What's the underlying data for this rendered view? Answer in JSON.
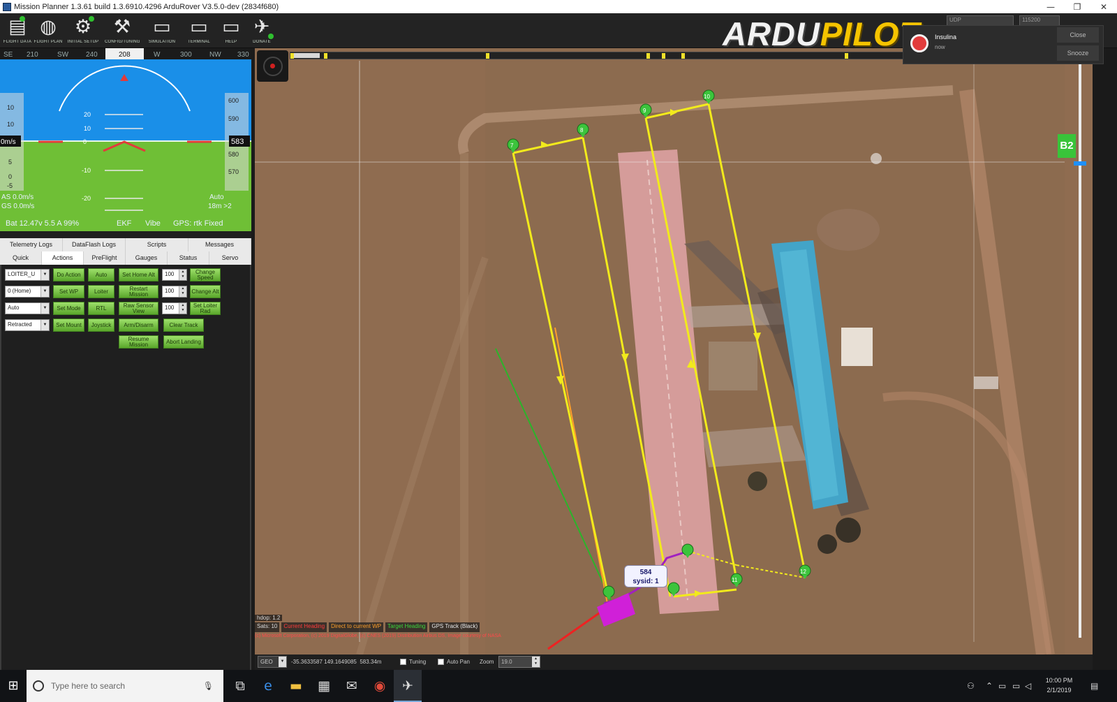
{
  "window": {
    "title": "Mission Planner 1.3.61 build 1.3.6910.4296 ArduRover V3.5.0-dev (2834f680)",
    "controls": [
      "—",
      "❐",
      "✕"
    ]
  },
  "toolbar": {
    "buttons": [
      {
        "label": "FLIGHT DATA",
        "glyph": "▤"
      },
      {
        "label": "FLIGHT PLAN",
        "glyph": "◍"
      },
      {
        "label": "INITIAL SETUP",
        "glyph": "⚙"
      },
      {
        "label": "CONFIG/TUNING",
        "glyph": "⚒"
      },
      {
        "label": "SIMULATION",
        "glyph": "▭"
      },
      {
        "label": "TERMINAL",
        "glyph": "▭"
      },
      {
        "label": "HELP",
        "glyph": "▭"
      },
      {
        "label": "DONATE",
        "glyph": "✈"
      }
    ],
    "logo_part1": "ARDU",
    "logo_part2": "PILOT",
    "connection_port": "UDP",
    "baud_rate": "115200"
  },
  "notification": {
    "title": "Insulina",
    "time": "now",
    "close_label": "Close",
    "snooze_label": "Snooze"
  },
  "hud": {
    "heading_ticks": [
      "SE",
      "210",
      "SW",
      "240",
      "W",
      "300",
      "NW",
      "330"
    ],
    "heading_value": "208",
    "ground_speed": "0m/s",
    "altitude": "583",
    "alt_ticks": [
      "600",
      "590",
      "580",
      "570"
    ],
    "speed_ticks": [
      "10",
      "10",
      "5",
      "0",
      "-5"
    ],
    "pitch_ticks": [
      "20",
      "10",
      "0",
      "-10",
      "-20"
    ],
    "airspeed": "AS 0.0m/s",
    "groundspeed": "GS 0.0m/s",
    "mode": "Auto",
    "wp_distance": "18m >2",
    "battery": "Bat 12.47v 5.5 A 99%",
    "ekf": "EKF",
    "vibe": "Vibe",
    "gps": "GPS: rtk Fixed",
    "colors": {
      "sky": "#1a8fe8",
      "ground": "#6fbf36"
    }
  },
  "tabs": {
    "row1": [
      "Telemetry Logs",
      "DataFlash Logs",
      "Scripts",
      "Messages"
    ],
    "row2": [
      "Quick",
      "Actions",
      "PreFlight",
      "Gauges",
      "Status",
      "Servo"
    ],
    "active": "Actions"
  },
  "actions": {
    "combos": [
      "LOITER_U",
      "0 (Home)",
      "Auto",
      "Retracted"
    ],
    "col1": [
      "Do Action",
      "Set WP",
      "Set Mode",
      "Set Mount"
    ],
    "col2": [
      "Auto",
      "Loiter",
      "RTL",
      "Joystick"
    ],
    "col3": [
      "Set Home Alt",
      "Restart Mission",
      "Raw Sensor View",
      "Arm/Disarm",
      "Resume Mission"
    ],
    "numbers": [
      "100",
      "100",
      "100"
    ],
    "col5": [
      "Change Speed",
      "Change Alt",
      "Set Loiter Rad",
      "Clear Track",
      "Abort Landing"
    ]
  },
  "map": {
    "waypoints": [
      "7",
      "8",
      "9",
      "10",
      "11",
      "12"
    ],
    "hdop": "hdop: 1.2",
    "sats": "Sats: 10",
    "legend": [
      {
        "label": "Current Heading",
        "color": "#ff3b3b"
      },
      {
        "label": "Direct to current WP",
        "color": "#ff9f2a"
      },
      {
        "label": "Target Heading",
        "color": "#3bd63b"
      },
      {
        "label": "GPS Track (Black)",
        "color": "#e8e8e8"
      }
    ],
    "attribution": "(c) Microsoft Corporation, (c) 2019 DigitalGlobe, (c) CNES (2019) Distribution Airbus DS, Image courtesy of NASA",
    "vehicle_alt": "584",
    "vehicle_sysid": "sysid: 1",
    "b2_label": "B2",
    "mission_color": "#f2ea1c"
  },
  "mapbar": {
    "coord_system": "GEO",
    "coordinates": "-35.3633587 149.1649085",
    "altitude": "583.34m",
    "tuning_label": "Tuning",
    "autopan_label": "Auto Pan",
    "zoom_label": "Zoom",
    "zoom_value": "19.0"
  },
  "taskbar": {
    "search_placeholder": "Type here to search",
    "time": "10:00 PM",
    "date": "2/1/2019"
  }
}
